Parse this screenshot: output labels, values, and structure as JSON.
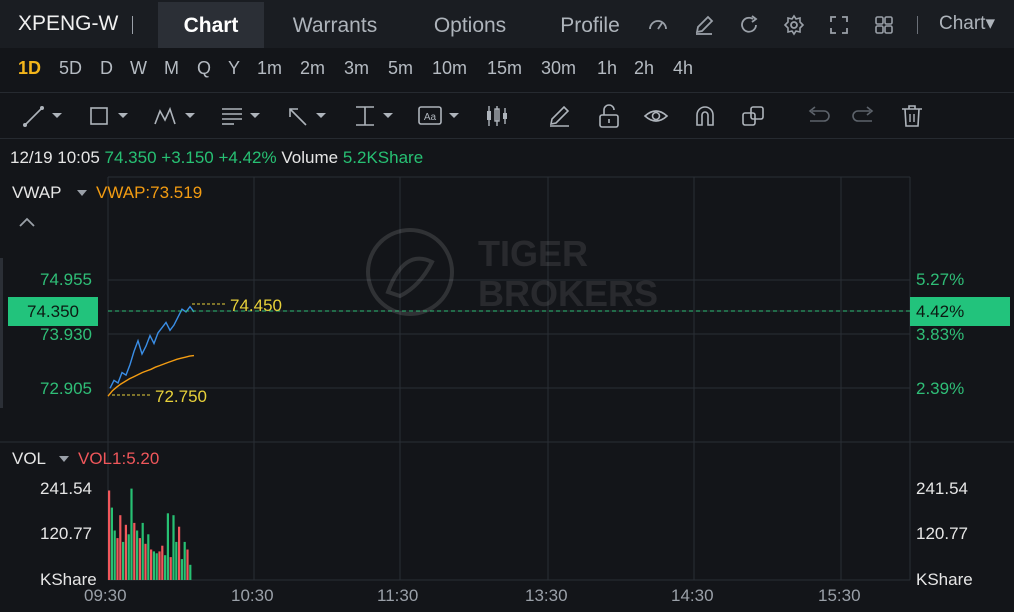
{
  "header": {
    "symbol": "XPENG-W",
    "tabs": [
      "Chart",
      "Warrants",
      "Options",
      "Profile"
    ],
    "chart_menu": "Chart▾",
    "icons": [
      "speedometer-icon",
      "edit-icon",
      "refresh-icon",
      "settings-icon",
      "fullscreen-icon",
      "grid-icon"
    ]
  },
  "periods": [
    "1D",
    "5D",
    "D",
    "W",
    "M",
    "Q",
    "Y",
    "1m",
    "2m",
    "3m",
    "5m",
    "10m",
    "15m",
    "30m",
    "1h",
    "2h",
    "4h"
  ],
  "active_period": "1D",
  "tools": [
    "line-tool-icon",
    "rectangle-tool-icon",
    "pattern-tool-icon",
    "fib-tool-icon",
    "arrow-tool-icon",
    "measure-tool-icon",
    "text-tool-icon",
    "candles-tool-icon",
    "pen-icon",
    "unlock-icon",
    "eye-icon",
    "magnet-icon",
    "clone-icon",
    "undo-icon",
    "redo-icon",
    "trash-icon"
  ],
  "info": {
    "datetime": "12/19 10:05",
    "price": "74.350",
    "change": "+3.150",
    "change_pct": "+4.42%",
    "volume_label": "Volume",
    "volume_value": "5.2KShare"
  },
  "indicator": {
    "name": "VWAP",
    "value_label": "VWAP:73.519",
    "collapse": "^"
  },
  "price_axis_left": [
    "74.955",
    "73.930",
    "72.905"
  ],
  "price_axis_right": [
    "5.27%",
    "3.83%",
    "2.39%"
  ],
  "current_price": "74.350",
  "current_pct": "4.42%",
  "high_label": "74.450",
  "low_label": "72.750",
  "volume_panel": {
    "name": "VOL",
    "value_label": "VOL1:5.20",
    "axis": [
      "241.54",
      "120.77",
      "KShare"
    ]
  },
  "time_axis": [
    "09:30",
    "10:30",
    "11:30",
    "13:30",
    "14:30",
    "15:30"
  ],
  "watermark": [
    "TIGER",
    "BROKERS"
  ],
  "colors": {
    "up": "#27c073",
    "down": "#f0575b",
    "price_line": "#3a8ee6",
    "vwap_line": "#f39c12",
    "accent": "#f3b51b"
  },
  "chart_data": {
    "type": "line",
    "ylim": [
      72.7,
      75.2
    ],
    "price_series": [
      72.9,
      73.05,
      73.0,
      73.2,
      73.15,
      73.35,
      73.6,
      73.8,
      73.55,
      73.7,
      73.9,
      73.75,
      73.95,
      74.05,
      74.15,
      74.0,
      74.1,
      74.25,
      74.4,
      74.35,
      74.45,
      74.35
    ],
    "vwap_series": [
      72.75,
      72.85,
      72.92,
      72.98,
      73.03,
      73.08,
      73.12,
      73.16,
      73.2,
      73.23,
      73.26,
      73.3,
      73.33,
      73.36,
      73.39,
      73.42,
      73.45,
      73.47,
      73.49,
      73.51,
      73.52
    ],
    "volume": {
      "ylim": [
        0,
        241.54
      ],
      "bars": [
        {
          "v": 235,
          "c": "down"
        },
        {
          "v": 190,
          "c": "up"
        },
        {
          "v": 130,
          "c": "up"
        },
        {
          "v": 110,
          "c": "down"
        },
        {
          "v": 170,
          "c": "down"
        },
        {
          "v": 100,
          "c": "up"
        },
        {
          "v": 145,
          "c": "down"
        },
        {
          "v": 120,
          "c": "up"
        },
        {
          "v": 240,
          "c": "up"
        },
        {
          "v": 150,
          "c": "down"
        },
        {
          "v": 130,
          "c": "up"
        },
        {
          "v": 110,
          "c": "down"
        },
        {
          "v": 150,
          "c": "up"
        },
        {
          "v": 95,
          "c": "down"
        },
        {
          "v": 120,
          "c": "up"
        },
        {
          "v": 80,
          "c": "down"
        },
        {
          "v": 75,
          "c": "up"
        },
        {
          "v": 70,
          "c": "up"
        },
        {
          "v": 75,
          "c": "down"
        },
        {
          "v": 90,
          "c": "down"
        },
        {
          "v": 65,
          "c": "up"
        },
        {
          "v": 175,
          "c": "up"
        },
        {
          "v": 60,
          "c": "down"
        },
        {
          "v": 170,
          "c": "up"
        },
        {
          "v": 100,
          "c": "up"
        },
        {
          "v": 140,
          "c": "down"
        },
        {
          "v": 55,
          "c": "up"
        },
        {
          "v": 100,
          "c": "up"
        },
        {
          "v": 80,
          "c": "down"
        },
        {
          "v": 40,
          "c": "up"
        }
      ]
    }
  }
}
